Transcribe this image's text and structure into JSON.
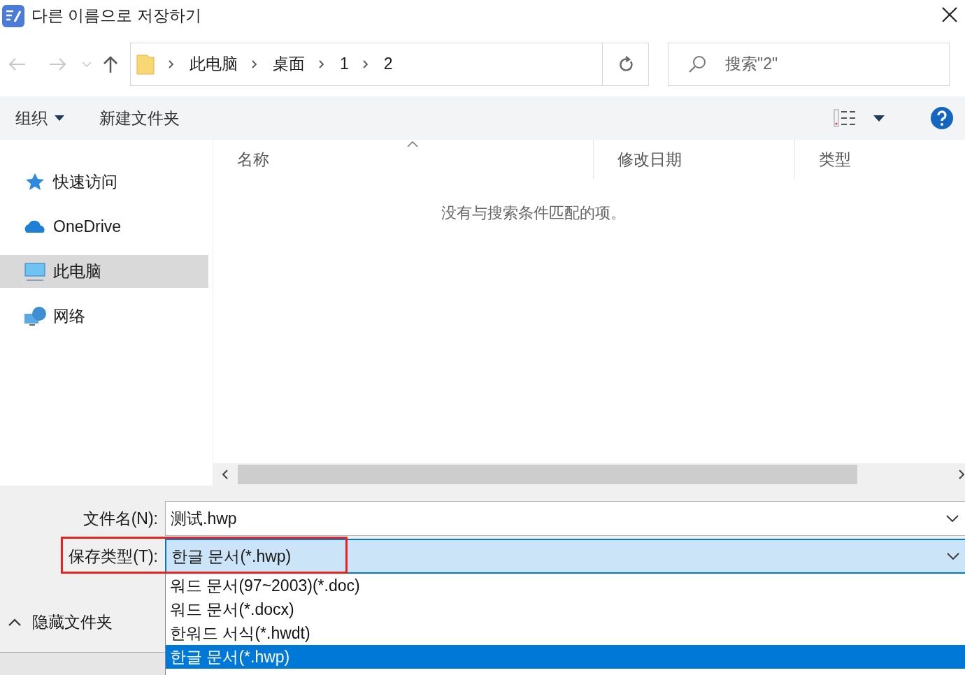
{
  "window": {
    "title": "다른 이름으로 저장하기"
  },
  "breadcrumb": [
    "此电脑",
    "桌面",
    "1",
    "2"
  ],
  "search": {
    "placeholder": "搜索\"2\""
  },
  "toolbar": {
    "organize": "组织",
    "new_folder": "新建文件夹"
  },
  "sidebar": {
    "items": [
      {
        "label": "快速访问",
        "kind": "star",
        "selected": false
      },
      {
        "label": "OneDrive",
        "kind": "cloud",
        "selected": false
      },
      {
        "label": "此电脑",
        "kind": "computer",
        "selected": true
      },
      {
        "label": "网络",
        "kind": "network",
        "selected": false
      }
    ]
  },
  "table": {
    "columns": [
      "名称",
      "修改日期",
      "类型"
    ],
    "empty_message": "没有与搜索条件匹配的项。"
  },
  "file_name": {
    "label": "文件名(N):",
    "value": "测试.hwp"
  },
  "save_type": {
    "label": "保存类型(T):",
    "value": "한글 문서(*.hwp)",
    "options": [
      {
        "label": "워드 문서(97~2003)(*.doc)",
        "selected": false
      },
      {
        "label": "워드 문서(*.docx)",
        "selected": false
      },
      {
        "label": "한워드 서식(*.hwdt)",
        "selected": false
      },
      {
        "label": "한글 문서(*.hwp)",
        "selected": true
      }
    ]
  },
  "hide_folders": "隐藏文件夹"
}
